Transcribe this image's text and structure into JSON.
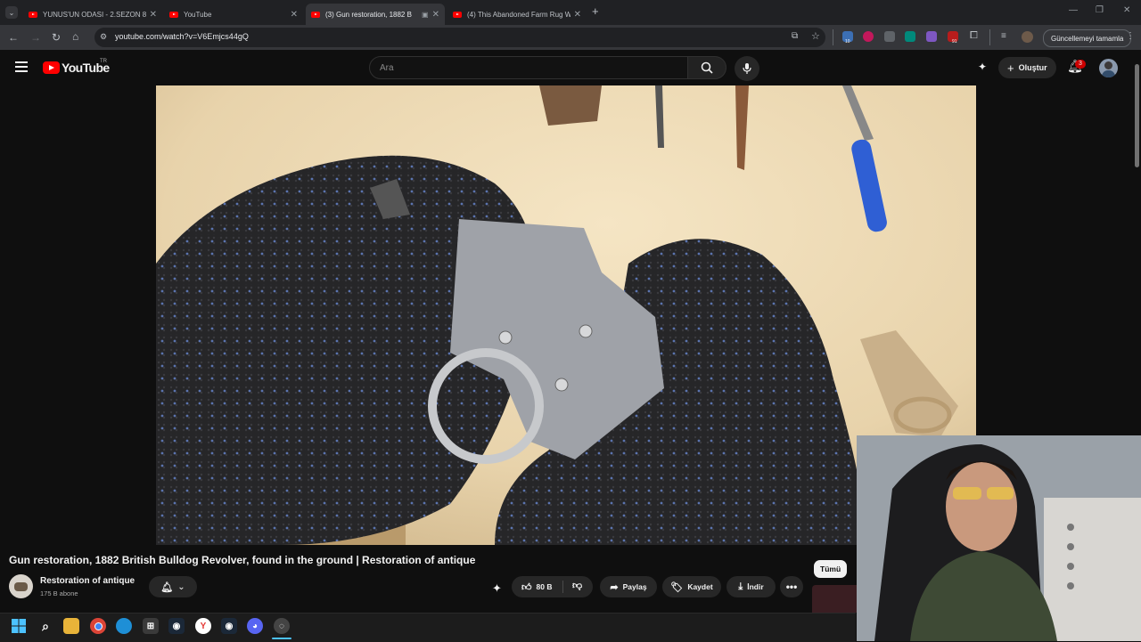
{
  "browser": {
    "tabs": [
      {
        "title": "YUNUS'UN ODASI - 2.SEZON 8",
        "active": false
      },
      {
        "title": "YouTube",
        "active": false
      },
      {
        "title": "(3) Gun restoration, 1882 B",
        "active": true
      },
      {
        "title": "(4) This Abandoned Farm Rug W",
        "active": false
      }
    ],
    "new_tab": "+",
    "url": "youtube.com/watch?v=V6Emjcs44gQ",
    "update_button": "Güncellemeyi tamamla",
    "badges": {
      "ext_count_1": "10",
      "ext_count_2": "91"
    }
  },
  "youtube": {
    "logo_text": "YouTube",
    "region": "TR",
    "search_placeholder": "Ara",
    "create_label": "Oluştur",
    "notifications_count": "3",
    "video": {
      "title": "Gun restoration, 1882 British Bulldog Revolver, found in the ground | Restoration of antique",
      "channel": "Restoration of antique",
      "subscribers": "175 B abone",
      "likes": "80 B",
      "share": "Paylaş",
      "save": "Kaydet",
      "download": "İndir"
    },
    "filter_chip": "Tümü"
  },
  "colors": {
    "accent": "#ff0000",
    "background": "#0f0f0f",
    "chip": "#272727",
    "notification": "#cc0000"
  }
}
